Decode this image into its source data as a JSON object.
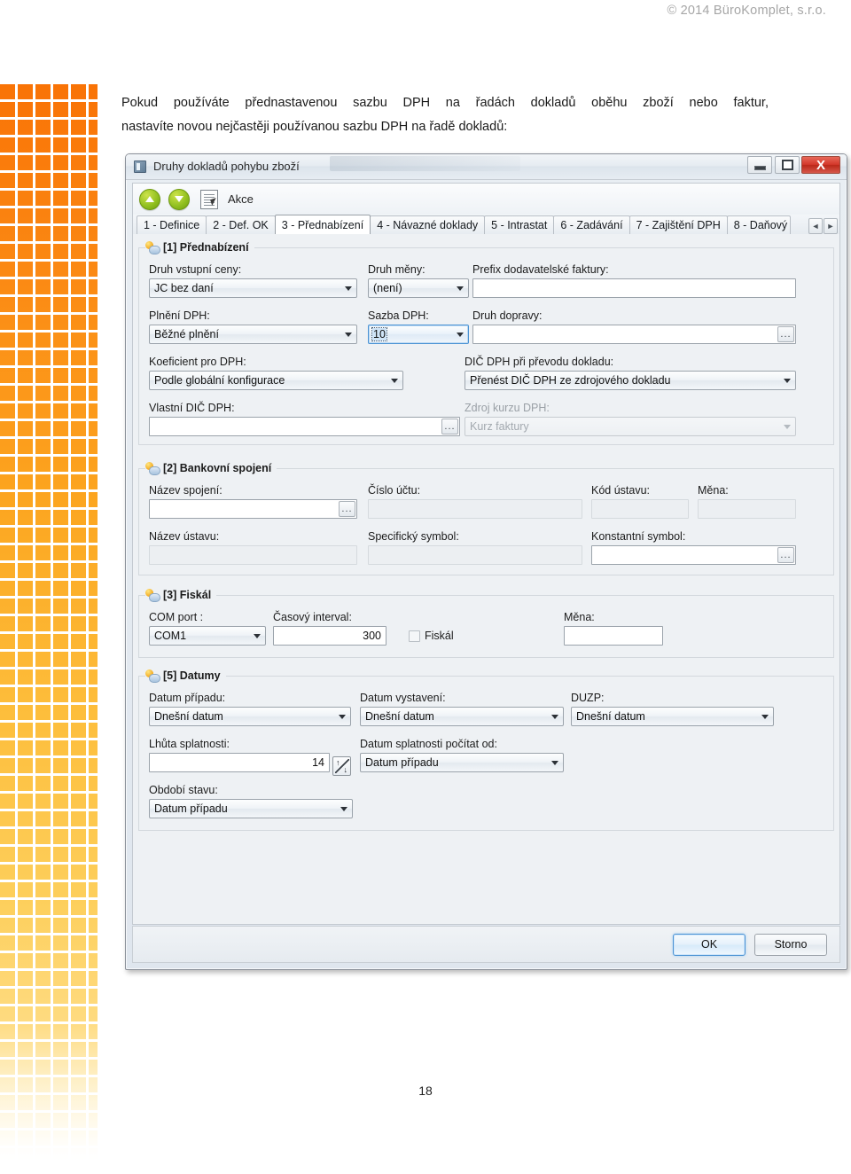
{
  "document": {
    "header": "© 2014 BüroKomplet, s.r.o.",
    "page_number": "18",
    "paragraph_line1": "Pokud používáte přednastavenou sazbu DPH na řadách dokladů oběhu zboží nebo faktur,",
    "paragraph_line2": "nastavíte novou nejčastěji používanou sazbu DPH na řadě dokladů:"
  },
  "window": {
    "title": "Druhy dokladů pohybu zboží",
    "buttons": {
      "minimize": "–",
      "maximize": "□",
      "close": "X"
    },
    "toolbar": {
      "up": "▲",
      "down": "▼",
      "akce": "Akce"
    },
    "tabs": [
      {
        "label": "1 - Definice",
        "active": false
      },
      {
        "label": "2 - Def. OK",
        "active": false
      },
      {
        "label": "3 - Přednabízení",
        "active": true
      },
      {
        "label": "4 - Návazné doklady",
        "active": false
      },
      {
        "label": "5 - Intrastat",
        "active": false
      },
      {
        "label": "6 - Zadávání",
        "active": false
      },
      {
        "label": "7 - Zajištění DPH",
        "active": false
      },
      {
        "label": "8 - Daňový",
        "active": false
      }
    ],
    "tab_scroll": {
      "left": "◄",
      "right": "►"
    }
  },
  "groups": {
    "prednabizeni": {
      "title": "[1] Přednabízení",
      "druh_vstupni_ceny": {
        "label": "Druh vstupní ceny:",
        "value": "JC bez daní"
      },
      "druh_meny": {
        "label": "Druh měny:",
        "value": "(není)"
      },
      "prefix_faktury": {
        "label": "Prefix dodavatelské faktury:",
        "value": ""
      },
      "plneni_dph": {
        "label": "Plnění DPH:",
        "value": "Běžné plnění"
      },
      "sazba_dph": {
        "label": "Sazba DPH:",
        "value": "10"
      },
      "druh_dopravy": {
        "label": "Druh dopravy:",
        "value": "",
        "dots": "..."
      },
      "koeficient_dph": {
        "label": "Koeficient pro DPH:",
        "value": "Podle globální konfigurace"
      },
      "dic_dph_prevod": {
        "label": "DIČ DPH při převodu dokladu:",
        "value": "Přenést DIČ DPH ze zdrojového dokladu"
      },
      "vlastni_dic_dph": {
        "label": "Vlastní DIČ DPH:",
        "value": "",
        "dots": "..."
      },
      "zdroj_kurzu_dph": {
        "label": "Zdroj kurzu DPH:",
        "value": "Kurz faktury"
      }
    },
    "bankovni_spojeni": {
      "title": "[2] Bankovní spojení",
      "nazev_spojeni": {
        "label": "Název spojení:",
        "value": "",
        "dots": "..."
      },
      "cislo_uctu": {
        "label": "Číslo účtu:",
        "value": ""
      },
      "kod_ustavu": {
        "label": "Kód ústavu:",
        "value": ""
      },
      "mena": {
        "label": "Měna:",
        "value": ""
      },
      "nazev_ustavu": {
        "label": "Název ústavu:",
        "value": ""
      },
      "specificky_symbol": {
        "label": "Specifický symbol:",
        "value": ""
      },
      "konstantni_symbol": {
        "label": "Konstantní symbol:",
        "value": "",
        "dots": "..."
      }
    },
    "fiskal": {
      "title": "[3] Fiskál",
      "com_port": {
        "label": "COM port :",
        "value": "COM1"
      },
      "casovy_interval": {
        "label": "Časový interval:",
        "value": "300"
      },
      "fiskal_checkbox": {
        "label": "Fiskál",
        "checked": false
      },
      "mena": {
        "label": "Měna:",
        "value": ""
      }
    },
    "datumy": {
      "title": "[5] Datumy",
      "datum_pripadu": {
        "label": "Datum případu:",
        "value": "Dnešní datum"
      },
      "datum_vystaveni": {
        "label": "Datum vystavení:",
        "value": "Dnešní datum"
      },
      "duzp": {
        "label": "DUZP:",
        "value": "Dnešní datum"
      },
      "lhuta_splatnosti": {
        "label": "Lhůta splatnosti:",
        "value": "14"
      },
      "datum_splatnosti_od": {
        "label": "Datum splatnosti počítat od:",
        "value": "Datum případu"
      },
      "obdobi_stavu": {
        "label": "Období stavu:",
        "value": "Datum případu"
      }
    }
  },
  "footer": {
    "ok": "OK",
    "storno": "Storno"
  },
  "colors": {
    "accent_orange": "#f97306",
    "accent_yellow": "#fdcf5c",
    "focus_blue": "#4c93d4",
    "close_red": "#d3372a",
    "toolbar_green": "#8fbe1e"
  }
}
